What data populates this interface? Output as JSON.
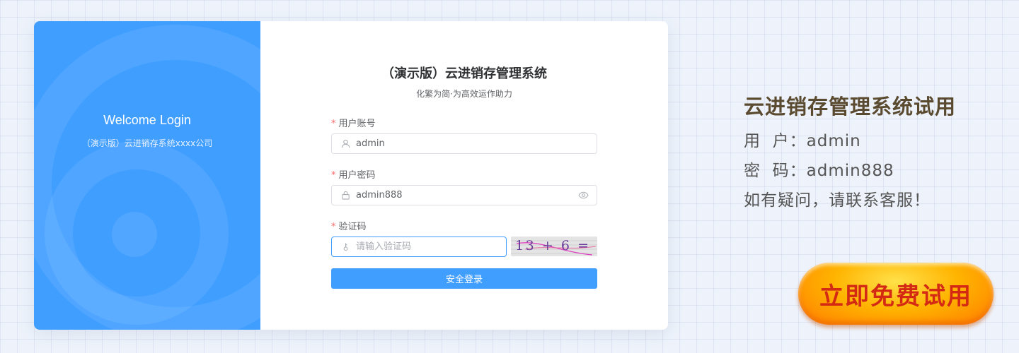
{
  "left_panel": {
    "title": "Welcome Login",
    "subtitle": "（演示版）云进销存系统xxxx公司"
  },
  "form": {
    "title": "（演示版）云进销存管理系统",
    "subtitle": "化繁为简·为高效运作助力",
    "required_mark": "*",
    "username": {
      "label": "用户账号",
      "value": "admin",
      "icon": "user-icon"
    },
    "password": {
      "label": "用户密码",
      "value": "admin888",
      "icon": "lock-icon",
      "toggle_icon": "eye-icon"
    },
    "captcha": {
      "label": "验证码",
      "placeholder": "请输入验证码",
      "icon": "key-icon",
      "image_text": "13 + 6 ="
    },
    "submit_label": "安全登录"
  },
  "promo": {
    "title": "云进销存管理系统试用",
    "user_line": "用  户：admin",
    "pass_line": "密  码：admin888",
    "help_line": "如有疑问，请联系客服！",
    "cta_label": "立即免费试用"
  },
  "colors": {
    "primary": "#409eff",
    "required": "#f56c6c",
    "cta_text": "#d42a14",
    "cta_fill": "#ffb400"
  }
}
